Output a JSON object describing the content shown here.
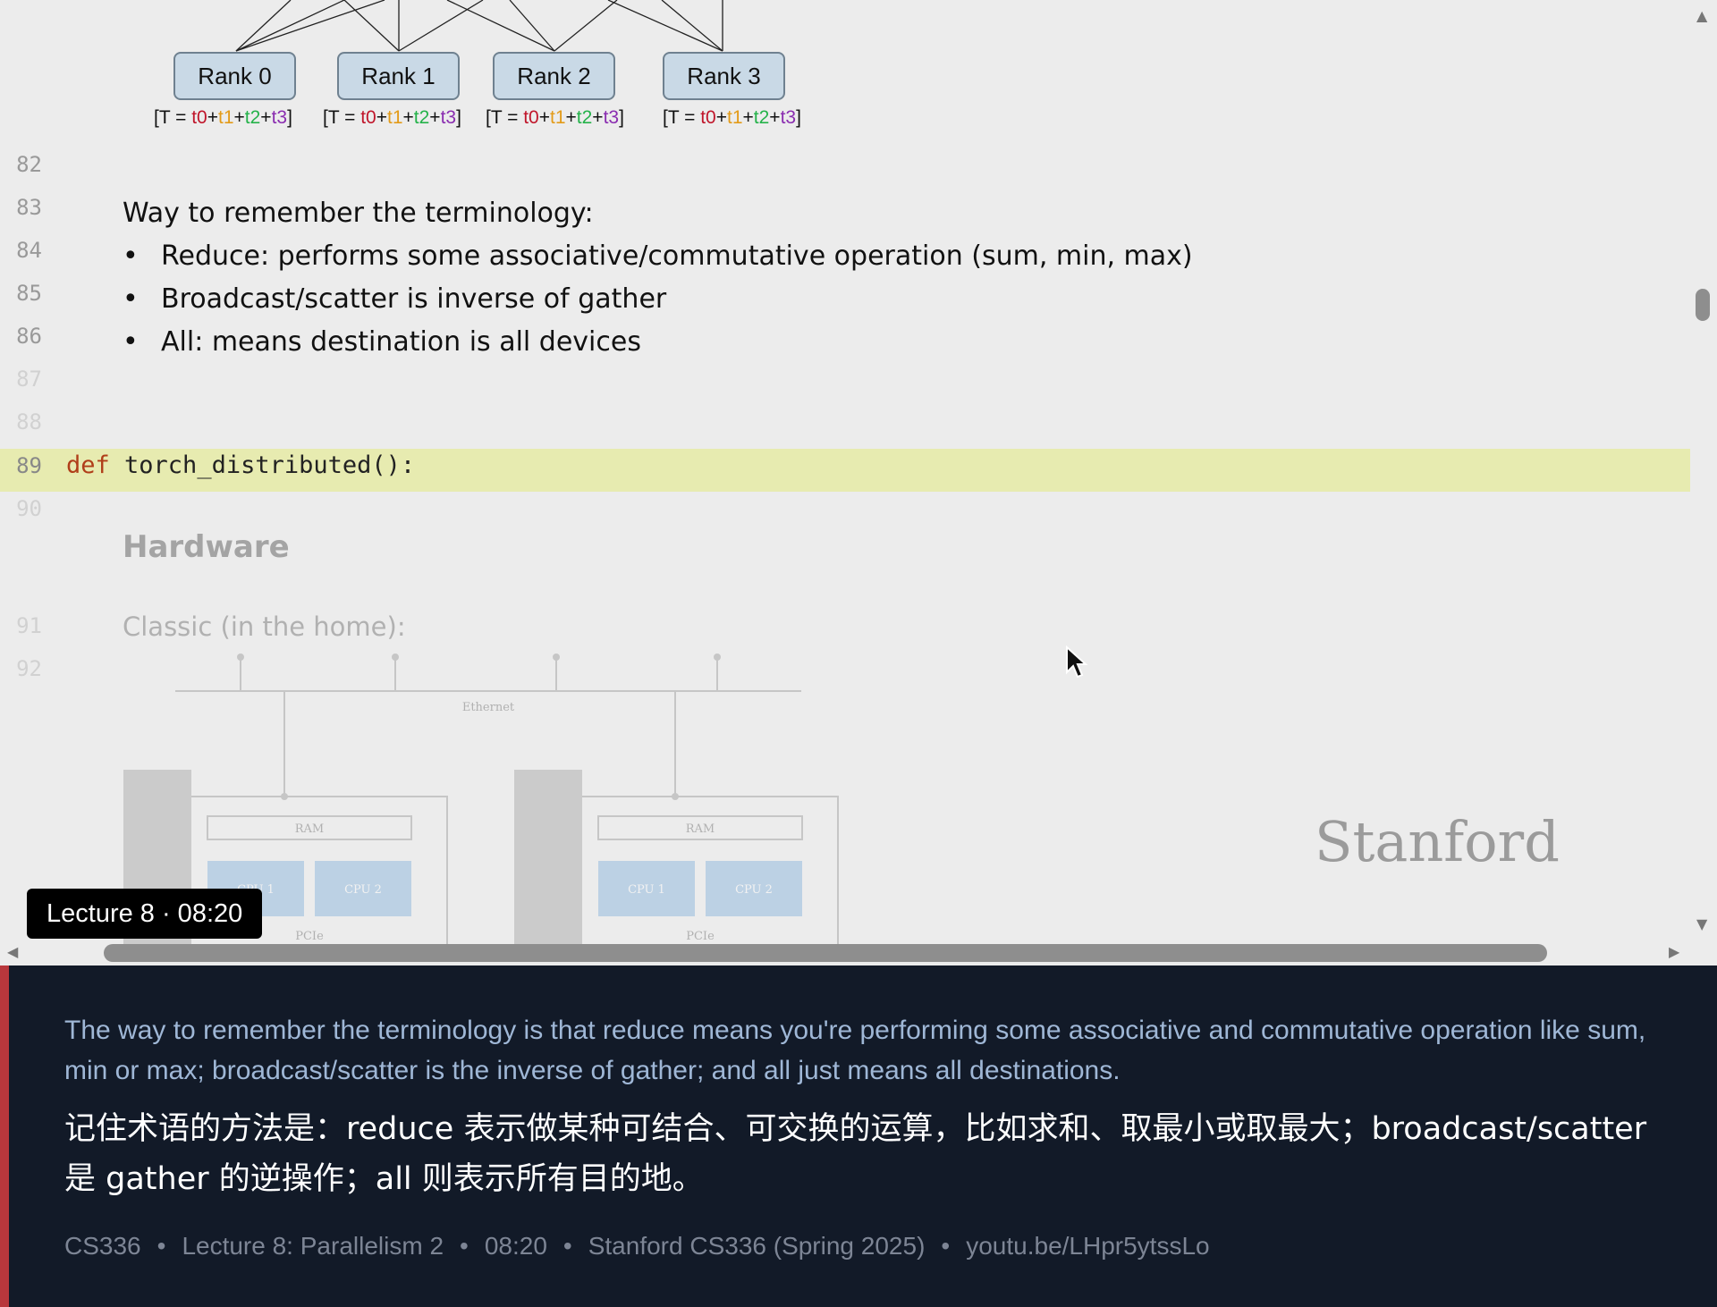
{
  "diagram": {
    "ranks": [
      "Rank 0",
      "Rank 1",
      "Rank 2",
      "Rank 3"
    ],
    "sum_label": {
      "prefix": "[T = ",
      "t0": "t0",
      "plus1": "+",
      "t1": "t1",
      "plus2": "+",
      "t2": "t2",
      "plus3": "+",
      "t3": "t3",
      "suffix": "]"
    },
    "term_colors": {
      "t0": "#c0162b",
      "t1": "#e39b19",
      "t2": "#25b24a",
      "t3": "#8a2db0"
    }
  },
  "editor": {
    "line_numbers": [
      "82",
      "83",
      "84",
      "85",
      "86",
      "87",
      "88",
      "89",
      "90",
      "91",
      "92"
    ],
    "heading": "Way to remember the terminology:",
    "bullets": [
      "Reduce: performs some associative/commutative operation (sum, min, max)",
      "Broadcast/scatter is inverse of gather",
      "All: means destination is all devices"
    ],
    "code_keyword": "def",
    "code_rest": " torch_distributed():",
    "highlight_color": "#e7ebb0",
    "section_title": "Hardware",
    "section_subtitle": "Classic (in the home):",
    "diagram2": {
      "ethernet": "Ethernet",
      "ram": "RAM",
      "cpu1": "CPU 1",
      "cpu2": "CPU 2",
      "pcie": "PCIe"
    }
  },
  "watermark": "Stanford",
  "badge": "Lecture 8 · 08:20",
  "subtitles": {
    "english": "The way to remember the terminology is that reduce means you're performing some associative and commutative operation like sum, min or max; broadcast/scatter is the inverse of gather; and all just means all destinations.",
    "chinese": "记住术语的方法是：reduce 表示做某种可结合、可交换的运算，比如求和、取最小或取最大；broadcast/scatter 是 gather 的逆操作；all 则表示所有目的地。"
  },
  "meta": {
    "course": "CS336",
    "lecture": "Lecture 8: Parallelism 2",
    "time": "08:20",
    "source": "Stanford CS336 (Spring 2025)",
    "link": "youtu.be/LHpr5ytssLo",
    "separator": "•"
  },
  "icons": {
    "scroll_up": "scroll-up-icon",
    "scroll_down": "scroll-down-icon",
    "scroll_left": "scroll-left-icon",
    "scroll_right": "scroll-right-icon",
    "cursor": "mouse-cursor-icon"
  }
}
